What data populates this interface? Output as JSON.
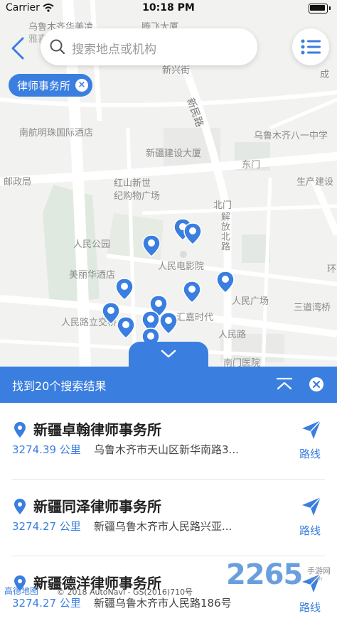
{
  "status_bar": {
    "carrier": "Carrier",
    "time": "10:18 PM"
  },
  "search": {
    "placeholder": "搜索地点或机构"
  },
  "filter_chip": {
    "label": "律师事务所",
    "close": "×"
  },
  "map_labels": [
    "乌鲁木齐华美凌",
    "雅喜",
    "腾飞大厦",
    "新兴街",
    "成",
    "新民路",
    "南航明珠国际酒店",
    "乌鲁木齐八一中学",
    "新疆建设大厦",
    "东门",
    "邮政局",
    "红山新世",
    "纪购物广场",
    "生产建设",
    "北门",
    "解放北路",
    "人民公园",
    "人民电影院",
    "美丽华酒店",
    "人民广场",
    "三道湾桥",
    "汇嘉时代",
    "人民路立交桥",
    "人民路",
    "南门医院",
    "环"
  ],
  "results_header": {
    "count_text": "找到20个搜索结果"
  },
  "results": [
    {
      "name": "新疆卓翰律师事务所",
      "distance": "3274.39 公里",
      "address": "乌鲁木齐市天山区新华南路3...",
      "route_label": "路线"
    },
    {
      "name": "新疆同泽律师事务所",
      "distance": "3274.27 公里",
      "address": "新疆乌鲁木齐市人民路兴亚...",
      "route_label": "路线"
    },
    {
      "name": "新疆德洋律师事务所",
      "distance": "3274.27 公里",
      "address": "新疆乌鲁木齐市人民路186号",
      "route_label": "路线"
    }
  ],
  "footer": {
    "logo": "高德地图",
    "copyright": "© 2018 AutoNavi - GS(2016)710号"
  },
  "watermark": {
    "brand": "2265",
    "sub": "手游网",
    "url": ".com"
  },
  "colors": {
    "accent": "#3a7ee0",
    "map_bg": "#f2f2f0",
    "road": "#ffffff"
  }
}
